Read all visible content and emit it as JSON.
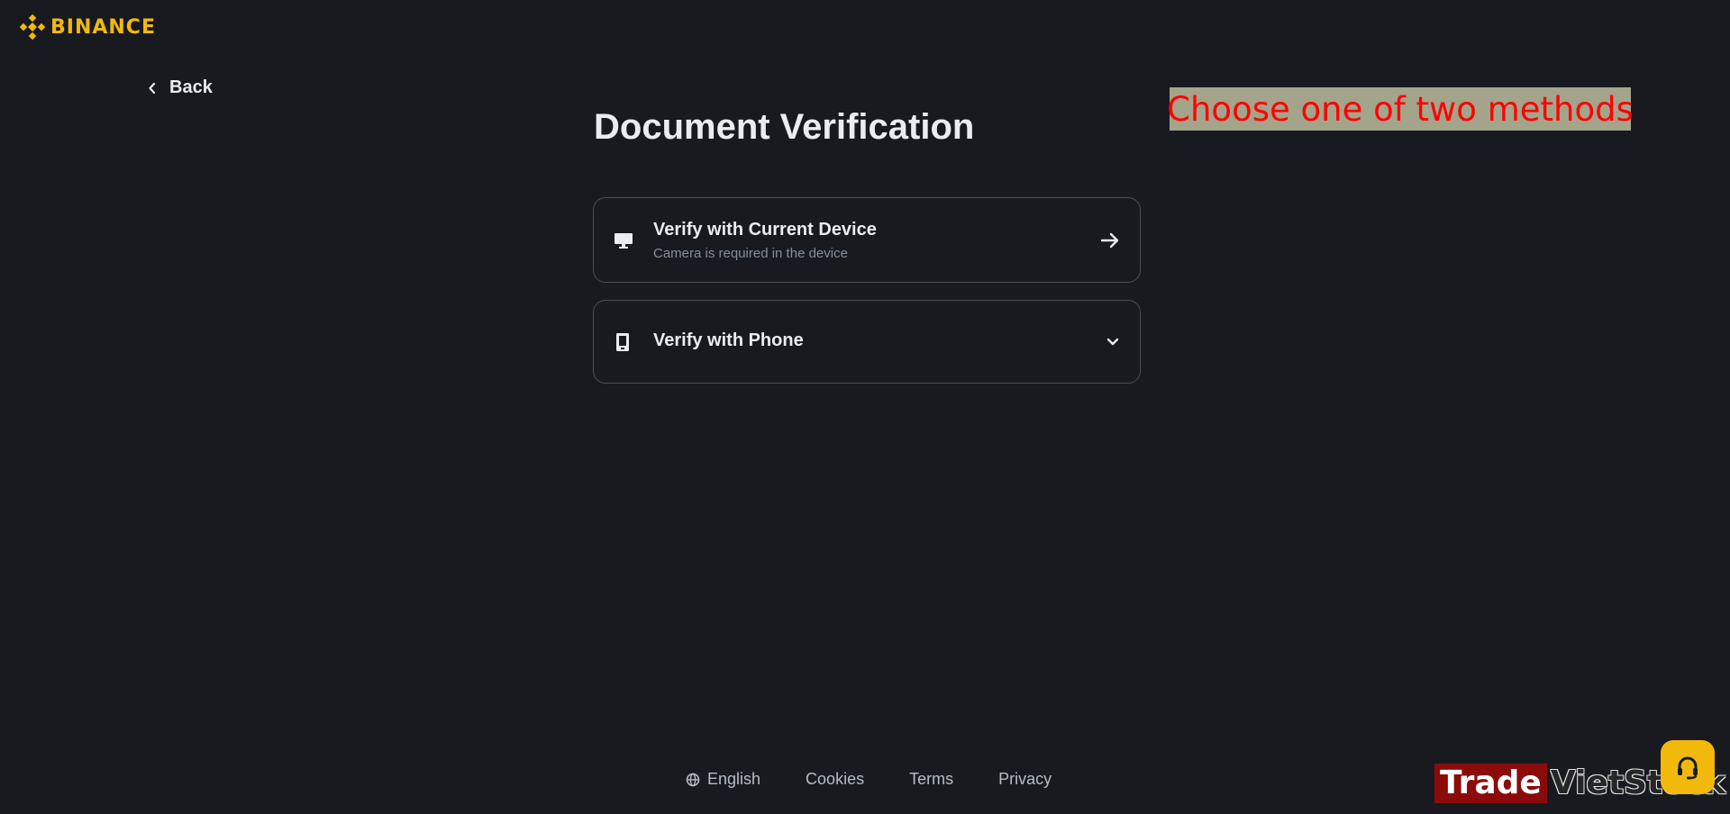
{
  "brand": {
    "name": "BINANCE",
    "color": "#f0b90b"
  },
  "nav": {
    "back_label": "Back"
  },
  "annotation": {
    "text": "Choose one of two methods",
    "text_color": "#ff0000",
    "background": "#a3a48a"
  },
  "page": {
    "title": "Document Verification"
  },
  "options": [
    {
      "title": "Verify with Current Device",
      "subtitle": "Camera is required in the device",
      "icon": "monitor-icon",
      "action_icon": "arrow-right-icon"
    },
    {
      "title": "Verify with Phone",
      "icon": "phone-icon",
      "action_icon": "chevron-down-icon"
    }
  ],
  "footer": {
    "language": "English",
    "cookies": "Cookies",
    "terms": "Terms",
    "privacy": "Privacy"
  },
  "watermark": {
    "part1": "Trade",
    "part2": "VietStock"
  },
  "colors": {
    "background": "#181a20",
    "border": "#474d57",
    "text": "#eaecef",
    "muted": "#848e9c",
    "accent": "#f0b90b"
  }
}
